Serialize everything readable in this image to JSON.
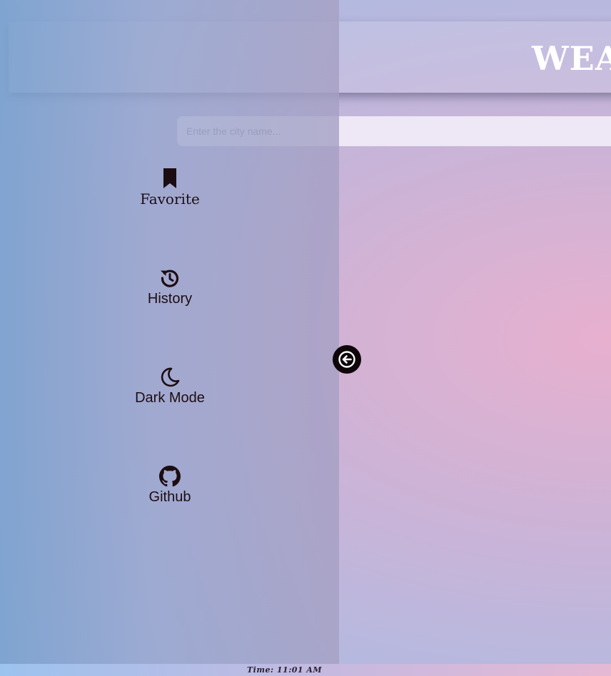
{
  "header": {
    "title": "WEA"
  },
  "search": {
    "placeholder": "Enter the city name..."
  },
  "sidebar": {
    "items": [
      {
        "label": "Favorite",
        "icon": "bookmark-icon"
      },
      {
        "label": "History",
        "icon": "history-icon"
      },
      {
        "label": "Dark Mode",
        "icon": "moon-icon"
      },
      {
        "label": "Github",
        "icon": "github-icon"
      }
    ],
    "toggle_icon": "arrow-left-circle-icon"
  },
  "footer": {
    "time": "Time: 11:01 AM"
  },
  "colors": {
    "icon": "#1c0d12",
    "title": "#ffffff",
    "accent_pink": "#e8b0cf",
    "accent_blue": "#a5bde4"
  }
}
